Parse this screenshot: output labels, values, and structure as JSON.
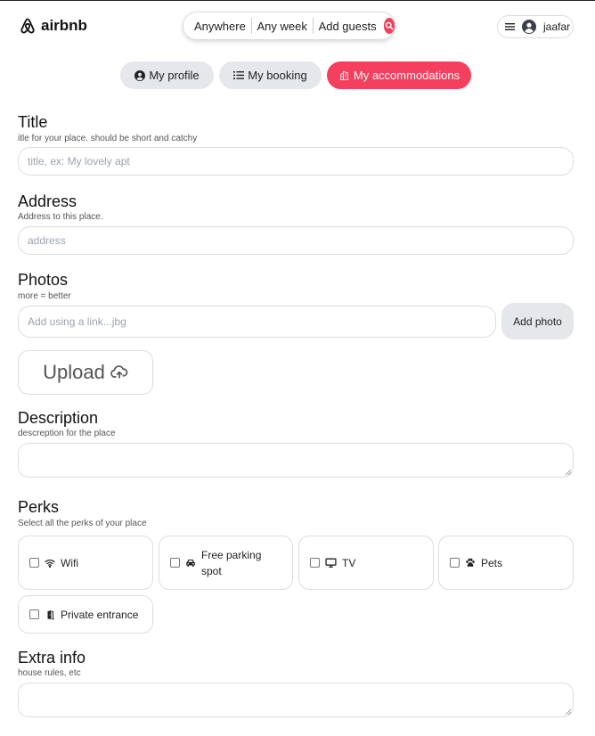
{
  "header": {
    "logo_text": "airbnb",
    "search": {
      "where": "Anywhere",
      "when": "Any week",
      "guests": "Add guests"
    },
    "user_name": "jaafar"
  },
  "nav": {
    "profile": "My profile",
    "booking": "My booking",
    "accommodations": "My accommodations"
  },
  "form": {
    "title": {
      "label": "Title",
      "hint": "itle for your place. should be short and catchy",
      "placeholder": "title, ex: My lovely apt"
    },
    "address": {
      "label": "Address",
      "hint": "Address to this place.",
      "placeholder": "address"
    },
    "photos": {
      "label": "Photos",
      "hint": "more = better",
      "placeholder": "Add using a link...jbg",
      "add_button": "Add photo",
      "upload_button": "Upload"
    },
    "description": {
      "label": "Description",
      "hint": "descreption for the place"
    },
    "perks": {
      "label": "Perks",
      "hint": "Select all the perks of your place",
      "items": [
        {
          "label": "Wifi",
          "icon": "wifi-icon"
        },
        {
          "label": "Free parking spot",
          "icon": "car-icon"
        },
        {
          "label": "TV",
          "icon": "tv-icon"
        },
        {
          "label": "Pets",
          "icon": "paw-icon"
        },
        {
          "label": "Private entrance",
          "icon": "door-icon"
        }
      ]
    },
    "extra": {
      "label": "Extra info",
      "hint": "house rules, etc"
    }
  },
  "colors": {
    "accent": "#f43f5e",
    "pill_bg": "#e5e7eb",
    "border": "#dddddd"
  }
}
